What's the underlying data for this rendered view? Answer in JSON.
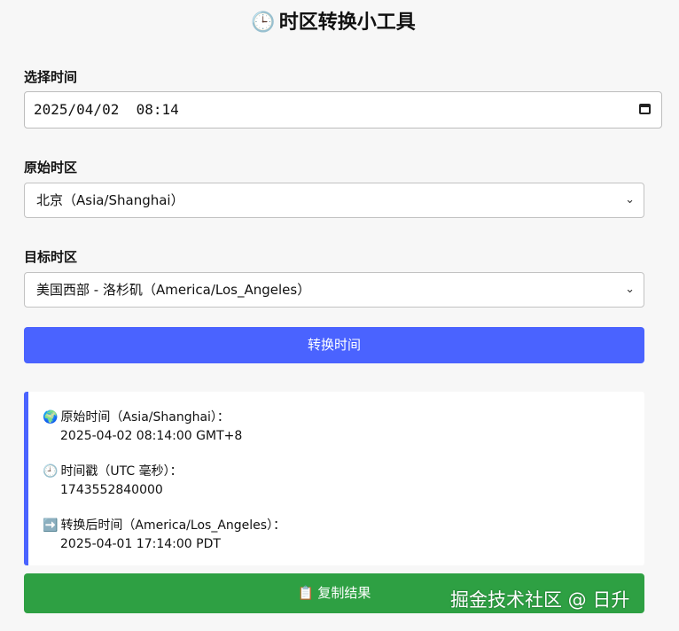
{
  "title": {
    "icon": "🕒",
    "text": "时区转换小工具"
  },
  "form": {
    "time_label": "选择时间",
    "time_value": "2025/04/02  08:14",
    "source_label": "原始时区",
    "source_value": "北京（Asia/Shanghai）",
    "target_label": "目标时区",
    "target_value": "美国西部 - 洛杉矶（America/Los_Angeles）",
    "chevron": "⌄",
    "convert_button": "转换时间"
  },
  "result": {
    "source": {
      "icon": "🌍",
      "label": "原始时间（Asia/Shanghai）：",
      "value": "2025-04-02 08:14:00 GMT+8"
    },
    "timestamp": {
      "icon": "🕘",
      "label": "时间戳（UTC 毫秒）：",
      "value": "1743552840000"
    },
    "converted": {
      "icon": "➡️",
      "label": "转换后时间（America/Los_Angeles）：",
      "value": "2025-04-01 17:14:00 PDT"
    }
  },
  "copy_button": {
    "icon": "📋",
    "text": "复制结果"
  },
  "watermark": "掘金技术社区 @ 日升",
  "colors": {
    "primary": "#4a63ff",
    "success": "#2ea043",
    "background": "#f7f7f7"
  }
}
